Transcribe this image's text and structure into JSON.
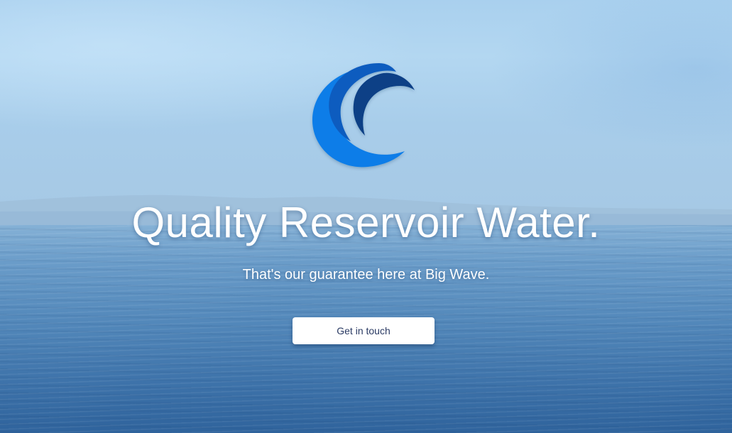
{
  "hero": {
    "headline": "Quality Reservoir Water.",
    "subheadline": "That's our guarantee here at Big Wave.",
    "cta_label": "Get in touch"
  },
  "logo": {
    "icon": "wave-logo-icon",
    "colors": [
      "#0a7de8",
      "#0b5bbf",
      "#0a3f86"
    ]
  },
  "colors": {
    "sky": "#a9d0ee",
    "sea": "#4a80b5",
    "button_bg": "#ffffff",
    "button_text": "#2a3a63",
    "headline_text": "#ffffff"
  }
}
